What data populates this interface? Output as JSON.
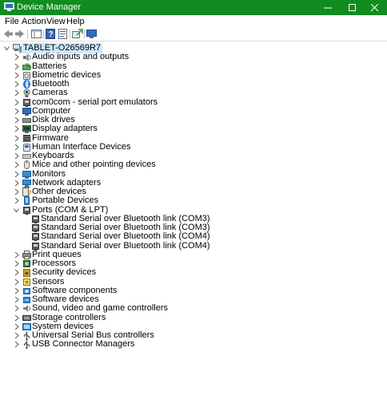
{
  "window": {
    "title": "Device Manager",
    "titlebar_color": "#118c20"
  },
  "menu": [
    "File",
    "Action",
    "View",
    "Help"
  ],
  "toolbar": {
    "buttons": [
      "back-icon",
      "forward-icon",
      "show-hide-console-tree-icon",
      "help-icon",
      "properties-icon",
      "update-driver-icon",
      "monitor-icon"
    ]
  },
  "tree": {
    "root": "TABLET-O26569R7",
    "categories": [
      {
        "label": "Audio inputs and outputs",
        "icon": "audio-icon"
      },
      {
        "label": "Batteries",
        "icon": "battery-icon"
      },
      {
        "label": "Biometric devices",
        "icon": "biometric-icon"
      },
      {
        "label": "Bluetooth",
        "icon": "bluetooth-icon"
      },
      {
        "label": "Cameras",
        "icon": "camera-icon"
      },
      {
        "label": "com0com - serial port emulators",
        "icon": "port-icon"
      },
      {
        "label": "Computer",
        "icon": "computer-icon"
      },
      {
        "label": "Disk drives",
        "icon": "disk-icon"
      },
      {
        "label": "Display adapters",
        "icon": "display-adapter-icon"
      },
      {
        "label": "Firmware",
        "icon": "firmware-icon"
      },
      {
        "label": "Human Interface Devices",
        "icon": "hid-icon"
      },
      {
        "label": "Keyboards",
        "icon": "keyboard-icon"
      },
      {
        "label": "Mice and other pointing devices",
        "icon": "mouse-icon"
      },
      {
        "label": "Monitors",
        "icon": "monitor-icon"
      },
      {
        "label": "Network adapters",
        "icon": "network-icon"
      },
      {
        "label": "Other devices",
        "icon": "other-device-icon"
      },
      {
        "label": "Portable Devices",
        "icon": "portable-device-icon"
      },
      {
        "label": "Ports (COM & LPT)",
        "icon": "port-icon",
        "expanded": true,
        "children": [
          "Standard Serial over Bluetooth link (COM3)",
          "Standard Serial over Bluetooth link (COM3)",
          "Standard Serial over Bluetooth link (COM4)",
          "Standard Serial over Bluetooth link (COM4)"
        ]
      },
      {
        "label": "Print queues",
        "icon": "printer-icon"
      },
      {
        "label": "Processors",
        "icon": "processor-icon"
      },
      {
        "label": "Security devices",
        "icon": "security-icon"
      },
      {
        "label": "Sensors",
        "icon": "sensor-icon"
      },
      {
        "label": "Software components",
        "icon": "software-component-icon"
      },
      {
        "label": "Software devices",
        "icon": "software-device-icon"
      },
      {
        "label": "Sound, video and game controllers",
        "icon": "sound-icon"
      },
      {
        "label": "Storage controllers",
        "icon": "storage-icon"
      },
      {
        "label": "System devices",
        "icon": "system-icon"
      },
      {
        "label": "Universal Serial Bus controllers",
        "icon": "usb-icon"
      },
      {
        "label": "USB Connector Managers",
        "icon": "usb-connector-icon"
      }
    ]
  }
}
